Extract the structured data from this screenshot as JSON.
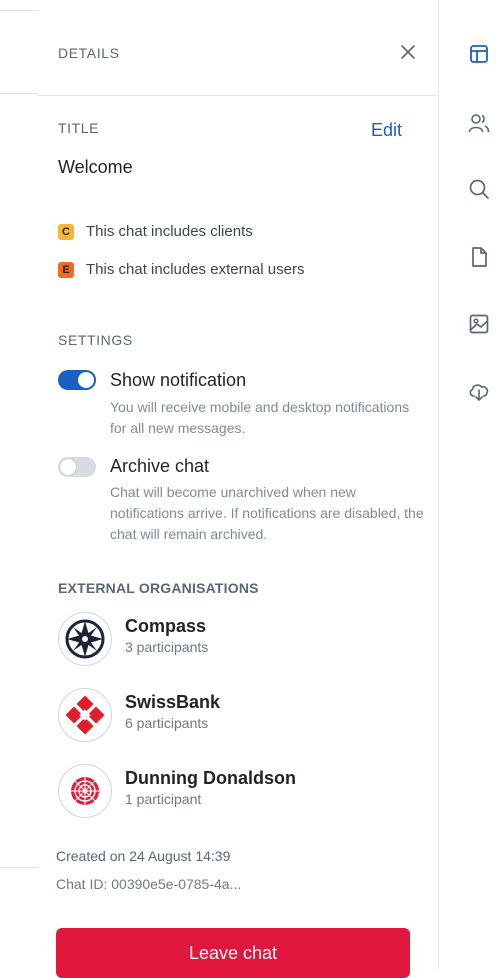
{
  "header": {
    "section_label": "DETAILS",
    "close_icon": "close-icon"
  },
  "title_section": {
    "label": "TITLE",
    "edit_label": "Edit",
    "value": "Welcome"
  },
  "badges": [
    {
      "letter": "C",
      "text": "This chat includes clients",
      "color": "#f7b733"
    },
    {
      "letter": "E",
      "text": "This chat includes external users",
      "color": "#f36b21"
    }
  ],
  "settings": {
    "label": "SETTINGS",
    "items": [
      {
        "title": "Show notification",
        "description": "You will receive mobile and desktop notifications for all new messages.",
        "enabled": true
      },
      {
        "title": "Archive chat",
        "description": "Chat will become unarchived when new notifications arrive. If notifications are disabled, the chat will remain archived.",
        "enabled": false
      }
    ]
  },
  "organisations": {
    "label": "EXTERNAL ORGANISATIONS",
    "items": [
      {
        "name": "Compass",
        "participants": "3 participants",
        "logo": "compass-logo"
      },
      {
        "name": "SwissBank",
        "participants": "6 participants",
        "logo": "swissbank-logo"
      },
      {
        "name": "Dunning Donaldson",
        "participants": "1 participant",
        "logo": "dunning-donaldson-logo"
      }
    ]
  },
  "meta": {
    "created": "Created on 24 August 14:39",
    "chat_id": "Chat ID: 00390e5e-0785-4a..."
  },
  "leave_button": "Leave chat",
  "colors": {
    "accent": "#1a5fc4",
    "danger": "#e1163c",
    "toggle_on": "#1a5fc4",
    "toggle_off": "#d7dce2"
  },
  "rail": [
    "layout-icon",
    "people-icon",
    "search-icon",
    "file-icon",
    "image-icon",
    "cloud-download-icon"
  ]
}
